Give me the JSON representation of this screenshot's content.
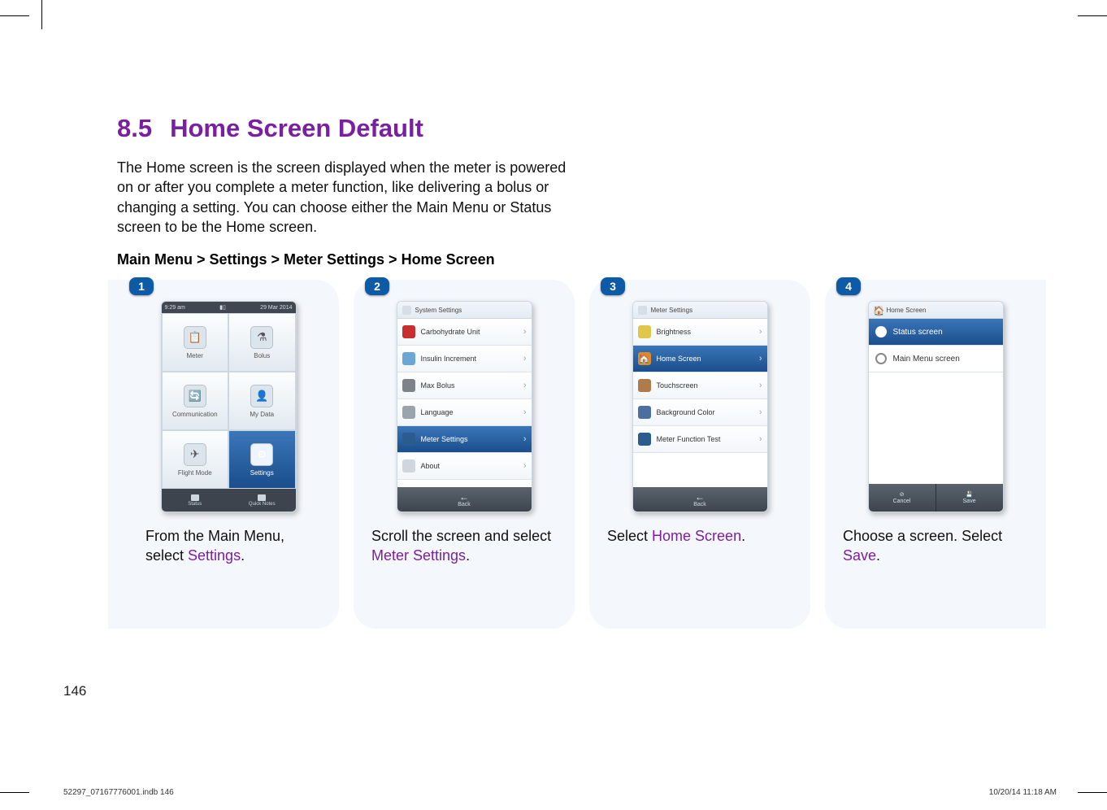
{
  "section": {
    "number": "8.5",
    "title": "Home Screen Default"
  },
  "intro": "The Home screen is the screen displayed when the meter is powered on or after you complete a meter function, like delivering a bolus or changing a setting. You can choose either the Main Menu or Status screen to be the Home screen.",
  "navpath": "Main Menu > Settings > Meter Settings > Home Screen",
  "page_number": "146",
  "footer_left": "52297_07167776001.indb   146",
  "footer_right": "10/20/14   11:18 AM",
  "steps": [
    {
      "num": "1",
      "caption_pre": "From the Main Menu, select ",
      "caption_accent": "Settings",
      "caption_post": "."
    },
    {
      "num": "2",
      "caption_pre": "Scroll the screen and select ",
      "caption_accent": "Meter Settings",
      "caption_post": "."
    },
    {
      "num": "3",
      "caption_pre": "Select ",
      "caption_accent": "Home Screen",
      "caption_post": "."
    },
    {
      "num": "4",
      "caption_pre": "Choose a screen. Select ",
      "caption_accent": "Save",
      "caption_post": "."
    }
  ],
  "phone1": {
    "status": {
      "time": "9:29 am",
      "date": "29 Mar 2014"
    },
    "tiles": [
      {
        "label": "Meter",
        "icon": "meter-icon"
      },
      {
        "label": "Bolus",
        "icon": "bolus-icon"
      },
      {
        "label": "Communication",
        "icon": "communication-icon"
      },
      {
        "label": "My Data",
        "icon": "mydata-icon"
      },
      {
        "label": "Flight Mode",
        "icon": "flight-icon"
      },
      {
        "label": "Settings",
        "icon": "gear-icon",
        "selected": true
      }
    ],
    "tabs": [
      {
        "label": "Status"
      },
      {
        "label": "Quick Notes"
      }
    ]
  },
  "phone2": {
    "header": "System Settings",
    "rows": [
      {
        "label": "Carbohydrate Unit",
        "icon_bg": "#c92e2e"
      },
      {
        "label": "Insulin Increment",
        "icon_bg": "#6aa6d6"
      },
      {
        "label": "Max Bolus",
        "icon_bg": "#7c838b"
      },
      {
        "label": "Language",
        "icon_bg": "#9aa4ac"
      },
      {
        "label": "Meter Settings",
        "icon_bg": "#2a5d8d",
        "selected": true
      },
      {
        "label": "About",
        "icon_bg": "#cfd6dd"
      }
    ],
    "back": "Back"
  },
  "phone3": {
    "header": "Meter Settings",
    "rows": [
      {
        "label": "Brightness",
        "icon_bg": "#e0c64a"
      },
      {
        "label": "Home Screen",
        "icon_bg": "#de8a2a",
        "selected": true
      },
      {
        "label": "Touchscreen",
        "icon_bg": "#b07b4c"
      },
      {
        "label": "Background Color",
        "icon_bg": "#4c6fa1"
      },
      {
        "label": "Meter Function Test",
        "icon_bg": "#2a5d8d"
      }
    ],
    "back": "Back"
  },
  "phone4": {
    "header": "Home Screen",
    "options": [
      {
        "label": "Status screen",
        "selected": true
      },
      {
        "label": "Main Menu screen",
        "selected": false
      }
    ],
    "actions": {
      "cancel": "Cancel",
      "save": "Save"
    }
  }
}
